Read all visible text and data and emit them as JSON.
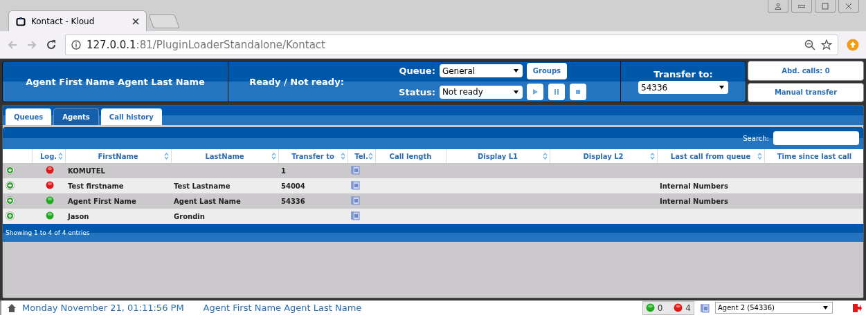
{
  "browser": {
    "tab_title": "Kontact - Kloud",
    "url_host": "127.0.0.1",
    "url_rest": ":81/PluginLoaderStandalone/Kontact"
  },
  "header": {
    "agent_name": "Agent First Name Agent Last Name",
    "ready_label": "Ready / Not ready:",
    "queue_label": "Queue:",
    "queue_value": "General",
    "status_label": "Status:",
    "status_value": "Not ready",
    "groups_button": "Groups",
    "transfer_label": "Transfer to:",
    "transfer_value": "54336",
    "abd_calls": "Abd. calls: 0",
    "manual_transfer": "Manual transfer"
  },
  "tabs": [
    {
      "label": "Queues",
      "selected": false
    },
    {
      "label": "Agents",
      "selected": true
    },
    {
      "label": "Call history",
      "selected": false
    }
  ],
  "search": {
    "label": "Search:"
  },
  "table": {
    "columns": [
      {
        "label": "Log.",
        "sortable": true
      },
      {
        "label": "FirstName",
        "sortable": true
      },
      {
        "label": "LastName",
        "sortable": true
      },
      {
        "label": "Transfer to",
        "sortable": true
      },
      {
        "label": "Tel.",
        "sortable": true
      },
      {
        "label": "Call length",
        "sortable": false
      },
      {
        "label": "Display L1",
        "sortable": true
      },
      {
        "label": "Display L2",
        "sortable": true
      },
      {
        "label": "Last call from queue",
        "sortable": true
      },
      {
        "label": "Time since last call",
        "sortable": false
      }
    ],
    "rows": [
      {
        "logged_in": false,
        "first": "KOMUTEL",
        "last": "",
        "transfer": "1",
        "queue": ""
      },
      {
        "logged_in": false,
        "first": "Test firstname",
        "last": "Test Lastname",
        "transfer": "54004",
        "queue": "Internal Numbers"
      },
      {
        "logged_in": true,
        "first": "Agent First Name",
        "last": "Agent Last Name",
        "transfer": "54336",
        "queue": "Internal Numbers"
      },
      {
        "logged_in": true,
        "first": "Jason",
        "last": "Grondin",
        "transfer": "",
        "queue": ""
      }
    ],
    "info": "Showing 1 to 4 of 4 entries"
  },
  "status_bar": {
    "datetime": "Monday November 21, 01:11:56 PM",
    "agent": "Agent First Name Agent Last Name",
    "online_count": "0",
    "offline_count": "4",
    "phone_select": "Agent 2 (54336)"
  }
}
